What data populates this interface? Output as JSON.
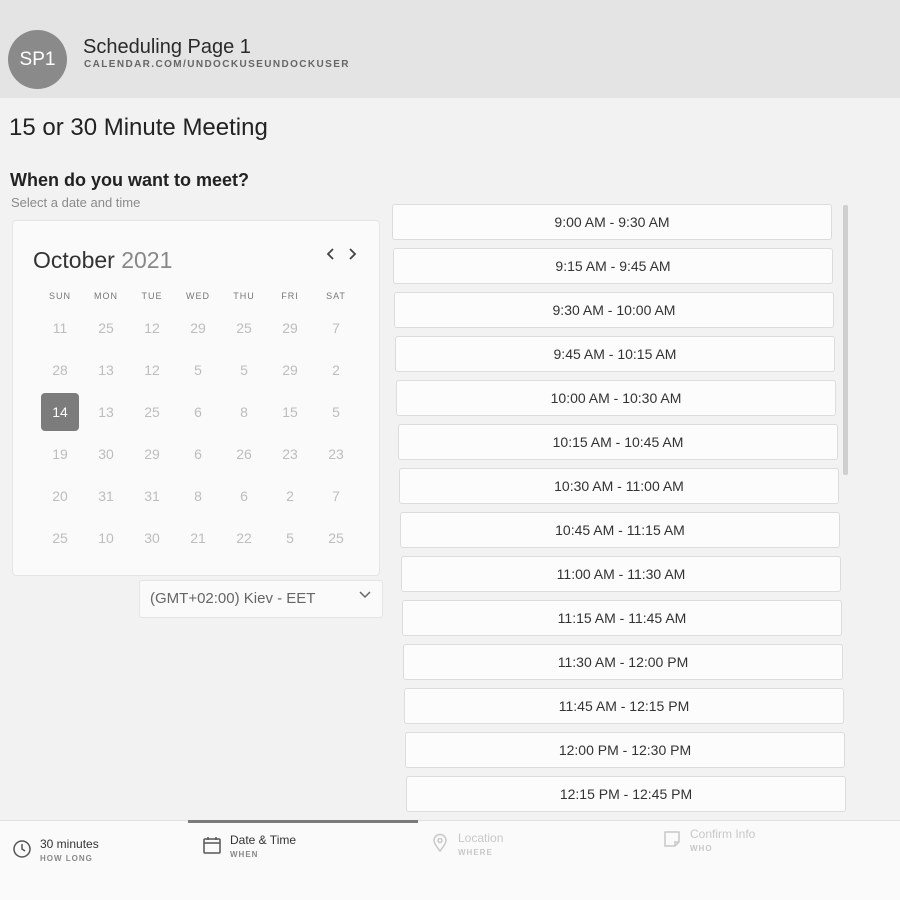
{
  "header": {
    "avatar": "SP1",
    "title": "Scheduling Page 1",
    "url": "CALENDAR.COM/UNDOCKUSEUNDOCKUSER"
  },
  "meeting": {
    "title": "15 or 30 Minute Meeting",
    "question": "When do you want to meet?",
    "subtitle": "Select a date and time"
  },
  "calendar": {
    "month": "October",
    "year": "2021",
    "days_of_week": [
      "SUN",
      "MON",
      "TUE",
      "WED",
      "THU",
      "FRI",
      "SAT"
    ],
    "weeks": [
      [
        "11",
        "25",
        "12",
        "29",
        "25",
        "29",
        "7"
      ],
      [
        "28",
        "13",
        "12",
        "5",
        "5",
        "29",
        "2"
      ],
      [
        "14",
        "13",
        "25",
        "6",
        "8",
        "15",
        "5"
      ],
      [
        "19",
        "30",
        "29",
        "6",
        "26",
        "23",
        "23"
      ],
      [
        "20",
        "31",
        "31",
        "8",
        "6",
        "2",
        "7"
      ],
      [
        "25",
        "10",
        "30",
        "21",
        "22",
        "5",
        "25"
      ]
    ],
    "selected_day": "14",
    "selected_color": "#7c7c7c"
  },
  "timezone": {
    "value": "(GMT+02:00) Kiev - EET"
  },
  "slots": [
    "9:00 AM - 9:30 AM",
    "9:15 AM - 9:45 AM",
    "9:30 AM - 10:00 AM",
    "9:45 AM - 10:15 AM",
    "10:00 AM - 10:30 AM",
    "10:15 AM - 10:45 AM",
    "10:30 AM - 11:00 AM",
    "10:45 AM - 11:15 AM",
    "11:00 AM - 11:30 AM",
    "11:15 AM - 11:45 AM",
    "11:30 AM - 12:00 PM",
    "11:45 AM - 12:15 PM",
    "12:00 PM - 12:30 PM",
    "12:15 PM - 12:45 PM"
  ],
  "steps": [
    {
      "label": "30 minutes",
      "sub": "HOW LONG",
      "icon": "clock-icon",
      "state": "done"
    },
    {
      "label": "Date & Time",
      "sub": "WHEN",
      "icon": "calendar-icon",
      "state": "active"
    },
    {
      "label": "Location",
      "sub": "WHERE",
      "icon": "map-pin-icon",
      "state": "disabled"
    },
    {
      "label": "Confirm Info",
      "sub": "WHO",
      "icon": "note-icon",
      "state": "disabled"
    }
  ]
}
